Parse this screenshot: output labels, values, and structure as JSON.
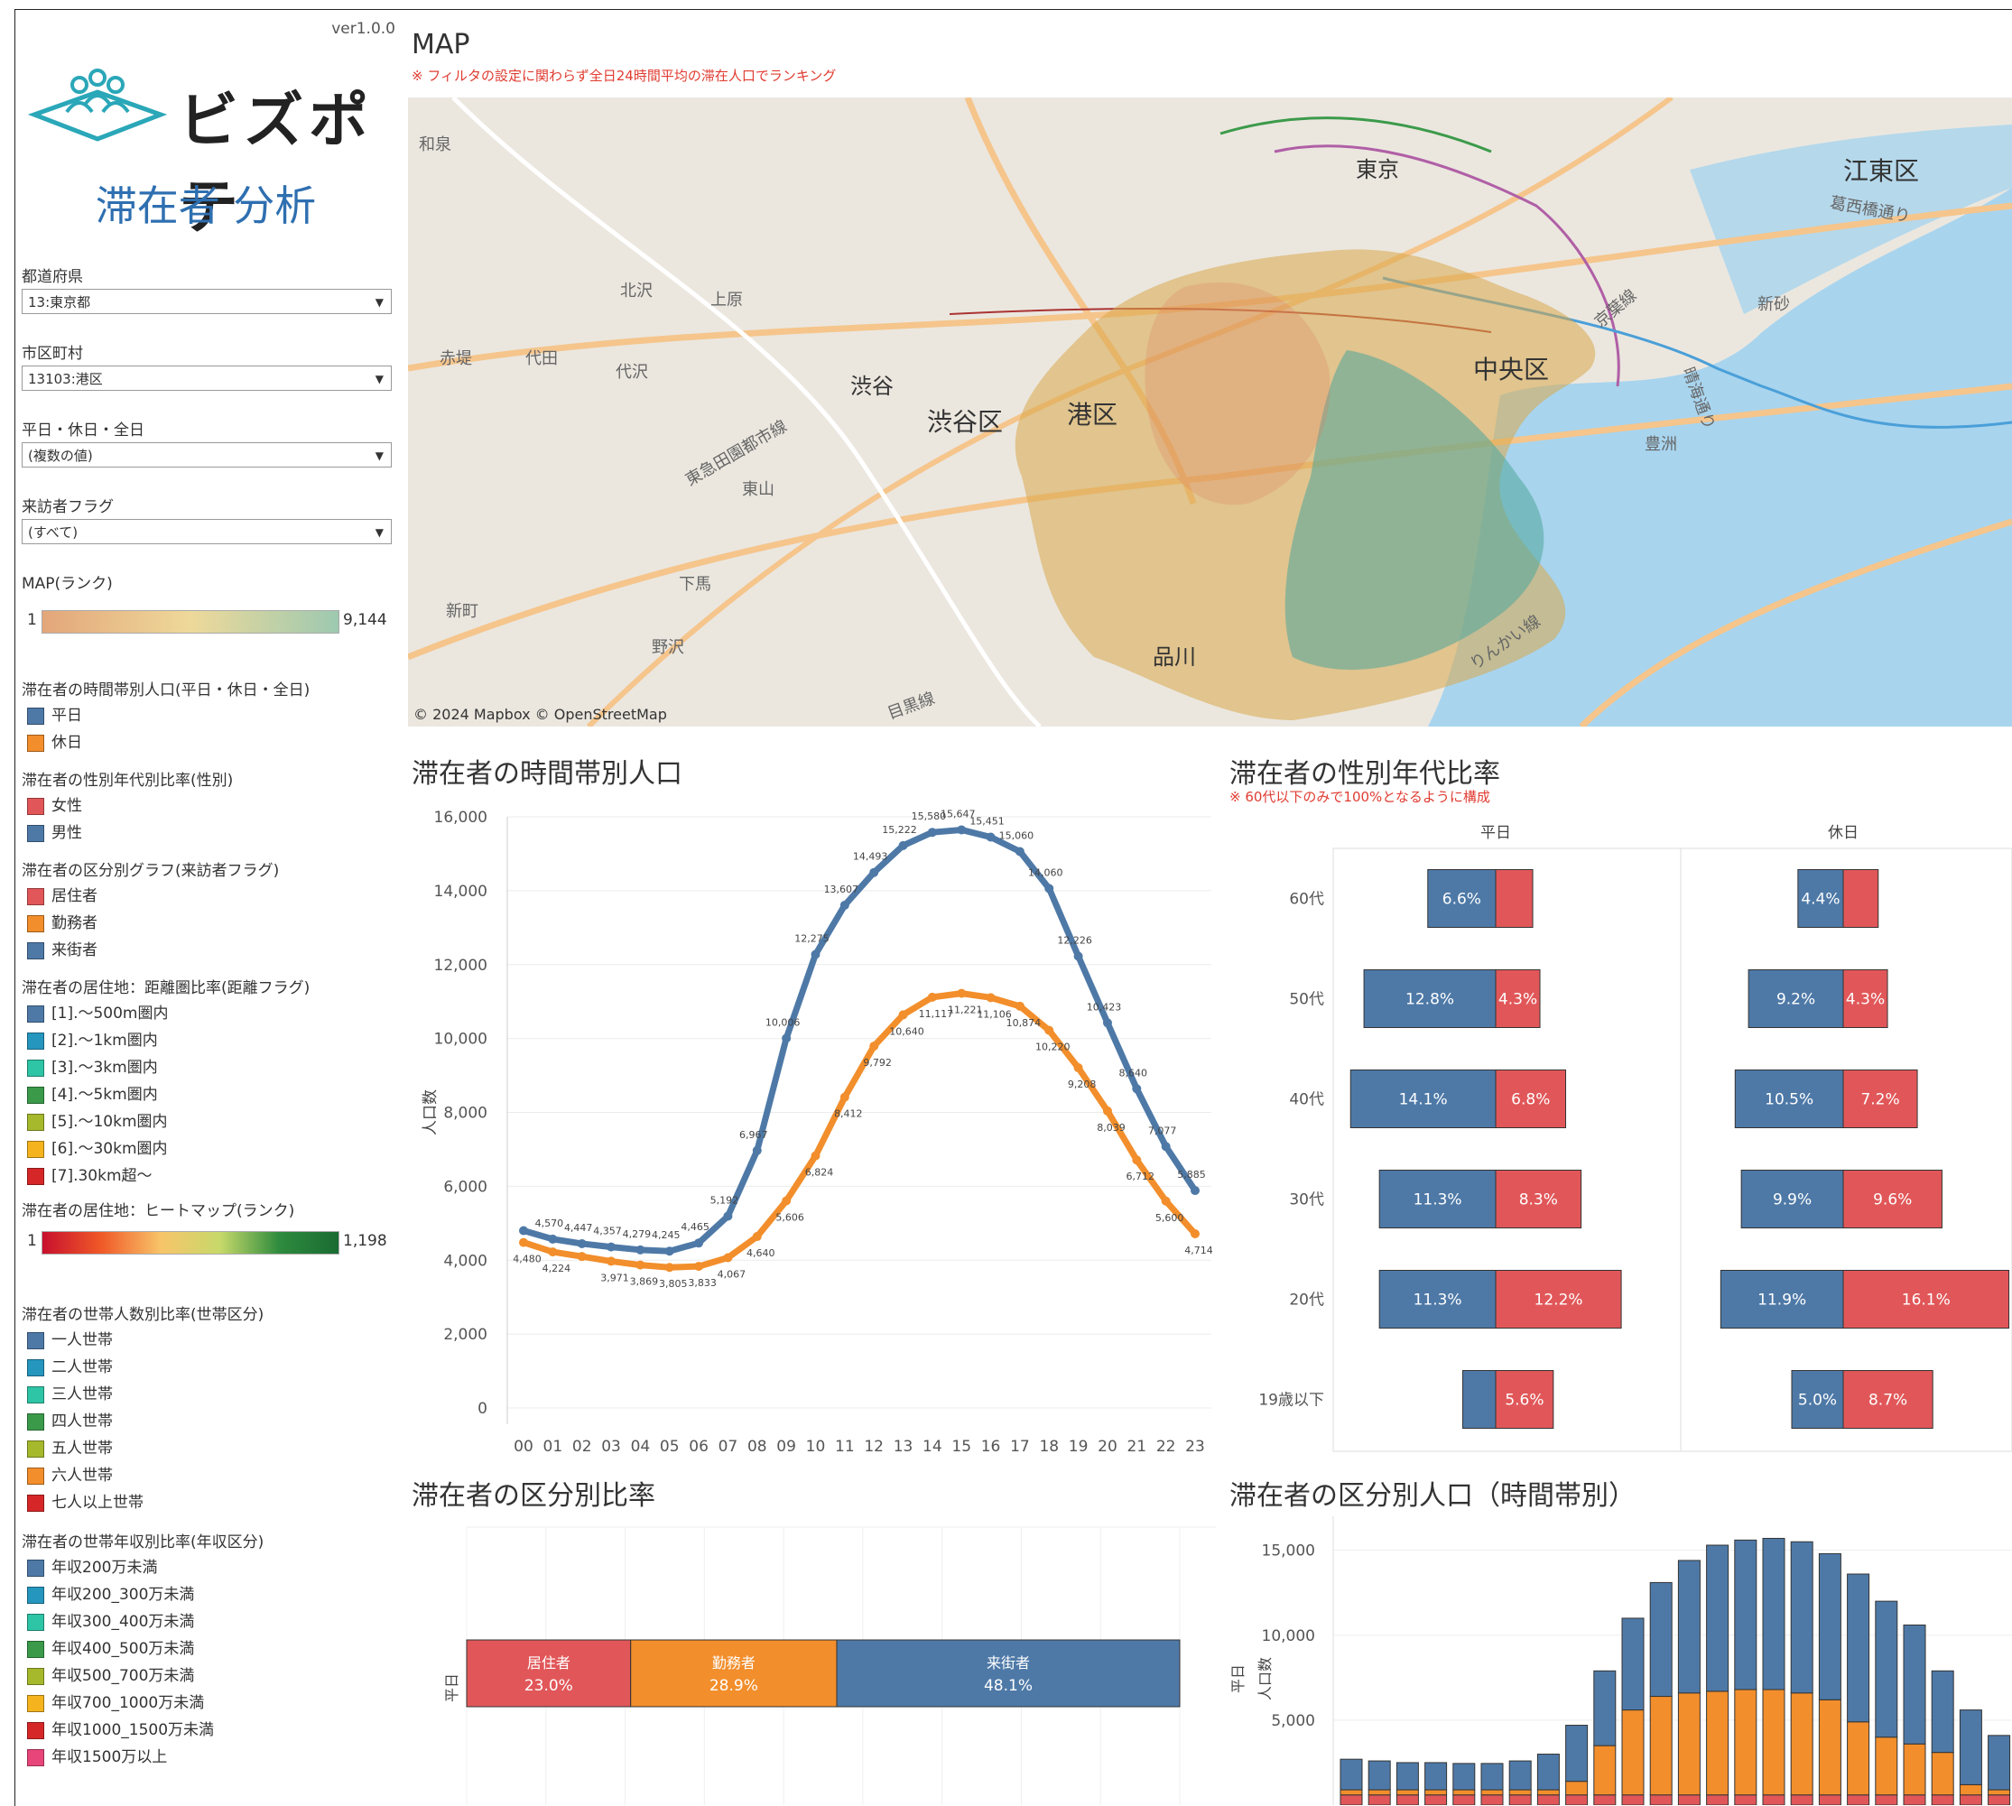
{
  "version": "ver1.0.0",
  "app": {
    "logo_text": "ビズポテ",
    "subtitle": "滞在者 分析"
  },
  "filters": [
    {
      "label": "都道府県",
      "value": "13:東京都"
    },
    {
      "label": "市区町村",
      "value": "13103:港区"
    },
    {
      "label": "平日・休日・全日",
      "value": "(複数の値)"
    },
    {
      "label": "来訪者フラグ",
      "value": "(すべて)"
    }
  ],
  "map_rank": {
    "title": "MAP(ランク)",
    "min": "1",
    "max": "9,144"
  },
  "legend_time": {
    "title": "滞在者の時間帯別人口(平日・休日・全日)",
    "items": [
      {
        "label": "平日",
        "color": "#4e79a7"
      },
      {
        "label": "休日",
        "color": "#f28e2b"
      }
    ]
  },
  "legend_gender": {
    "title": "滞在者の性別年代別比率(性別)",
    "items": [
      {
        "label": "女性",
        "color": "#e15759"
      },
      {
        "label": "男性",
        "color": "#4e79a7"
      }
    ]
  },
  "legend_kubun": {
    "title": "滞在者の区分別グラフ(来訪者フラグ)",
    "items": [
      {
        "label": "居住者",
        "color": "#e15759"
      },
      {
        "label": "勤務者",
        "color": "#f28e2b"
      },
      {
        "label": "来街者",
        "color": "#4e79a7"
      }
    ]
  },
  "legend_distance": {
    "title": "滞在者の居住地：距離圏比率(距離フラグ)",
    "items": [
      {
        "label": "[1].〜500m圏内",
        "color": "#4e79a7"
      },
      {
        "label": "[2].〜1km圏内",
        "color": "#2596be"
      },
      {
        "label": "[3].〜3km圏内",
        "color": "#2ec4a6"
      },
      {
        "label": "[4].〜5km圏内",
        "color": "#3a9a4a"
      },
      {
        "label": "[5].〜10km圏内",
        "color": "#a6b82c"
      },
      {
        "label": "[6].〜30km圏内",
        "color": "#f5b41e"
      },
      {
        "label": "[7].30km超〜",
        "color": "#d62728"
      }
    ]
  },
  "heatmap_rank": {
    "title": "滞在者の居住地：ヒートマップ(ランク)",
    "min": "1",
    "max": "1,198"
  },
  "legend_household": {
    "title": "滞在者の世帯人数別比率(世帯区分)",
    "items": [
      {
        "label": "一人世帯",
        "color": "#4e79a7"
      },
      {
        "label": "二人世帯",
        "color": "#2596be"
      },
      {
        "label": "三人世帯",
        "color": "#2ec4a6"
      },
      {
        "label": "四人世帯",
        "color": "#3a9a4a"
      },
      {
        "label": "五人世帯",
        "color": "#a6b82c"
      },
      {
        "label": "六人世帯",
        "color": "#f28e2b"
      },
      {
        "label": "七人以上世帯",
        "color": "#d62728"
      }
    ]
  },
  "legend_income": {
    "title": "滞在者の世帯年収別比率(年収区分)",
    "items": [
      {
        "label": "年収200万未満",
        "color": "#4e79a7"
      },
      {
        "label": "年収200_300万未満",
        "color": "#2596be"
      },
      {
        "label": "年収300_400万未満",
        "color": "#2ec4a6"
      },
      {
        "label": "年収400_500万未満",
        "color": "#3a9a4a"
      },
      {
        "label": "年収500_700万未満",
        "color": "#a6b82c"
      },
      {
        "label": "年収700_1000万未満",
        "color": "#f5b41e"
      },
      {
        "label": "年収1000_1500万未満",
        "color": "#d62728"
      },
      {
        "label": "年収1500万以上",
        "color": "#e8457a"
      }
    ]
  },
  "map": {
    "title": "MAP",
    "note": "※ フィルタの設定に関わらず全日24時間平均の滞在人口でランキング",
    "credit": "© 2024 Mapbox © OpenStreetMap",
    "labels": {
      "koto": "江東区",
      "chuo": "中央区",
      "shibuya_ku": "渋谷区",
      "minato": "港区",
      "tokyo": "東京",
      "shibuya": "渋谷",
      "shinagawa": "品川",
      "wasen": "和泉",
      "kitazawa": "北沢",
      "uehara": "上原",
      "akatsutsumi": "赤堤",
      "daita": "代田",
      "daizawa": "代沢",
      "higashiyama": "東山",
      "shimouma": "下馬",
      "shincho": "新町",
      "nozawa": "野沢",
      "shinsuna": "新砂",
      "toyosu": "豊洲",
      "rinkai": "りんかい線",
      "meguro": "目黒線",
      "denentoshi": "東急田園都市線",
      "keiyo": "京葉線",
      "harumi": "晴海通り",
      "kasai": "葛西橋通り"
    }
  },
  "chart_time": {
    "title": "滞在者の時間帯別人口",
    "ylabel": "人口数",
    "chart_data": {
      "type": "line",
      "x": [
        "00",
        "01",
        "02",
        "03",
        "04",
        "05",
        "06",
        "07",
        "08",
        "09",
        "10",
        "11",
        "12",
        "13",
        "14",
        "15",
        "16",
        "17",
        "18",
        "19",
        "20",
        "21",
        "22",
        "23"
      ],
      "ylim": [
        0,
        16000
      ],
      "yticks": [
        "0",
        "2,000",
        "4,000",
        "6,000",
        "8,000",
        "10,000",
        "12,000",
        "14,000",
        "16,000"
      ],
      "series": [
        {
          "name": "平日",
          "color": "#4e79a7",
          "values": [
            4800,
            4570,
            4447,
            4357,
            4279,
            4245,
            4465,
            5192,
            6967,
            10006,
            12275,
            13607,
            14493,
            15222,
            15580,
            15647,
            15451,
            15060,
            14060,
            12226,
            10423,
            8640,
            7077,
            5885
          ],
          "labels": [
            "",
            "4,570",
            "4,447",
            "4,357",
            "4,279",
            "4,245",
            "4,465",
            "5,192",
            "6,967",
            "10,006",
            "12,275",
            "13,607",
            "14,493",
            "15,222",
            "15,580",
            "15,647",
            "15,451",
            "15,060",
            "14,060",
            "12,226",
            "10,423",
            "8,640",
            "7,077",
            "5,885"
          ]
        },
        {
          "name": "休日",
          "color": "#f28e2b",
          "values": [
            4480,
            4224,
            4100,
            3971,
            3869,
            3805,
            3833,
            4067,
            4640,
            5606,
            6824,
            8412,
            9792,
            10640,
            11117,
            11221,
            11106,
            10874,
            10220,
            9208,
            8039,
            6712,
            5600,
            4714
          ],
          "labels": [
            "4,480",
            "4,224",
            "",
            "3,971",
            "3,869",
            "3,805",
            "3,833",
            "4,067",
            "4,640",
            "5,606",
            "6,824",
            "8,412",
            "9,792",
            "10,640",
            "11,117",
            "11,221",
            "11,106",
            "10,874",
            "10,220",
            "9,208",
            "8,039",
            "6,712",
            "5,600",
            "4,714"
          ]
        }
      ]
    }
  },
  "chart_gender": {
    "title": "滞在者の性別年代比率",
    "note": "※ 60代以下のみで100%となるように構成",
    "chart_data": {
      "type": "bar",
      "categories": [
        "60代",
        "50代",
        "40代",
        "30代",
        "20代",
        "19歳以下"
      ],
      "panels": [
        {
          "name": "平日",
          "male": [
            6.6,
            12.8,
            14.1,
            11.3,
            11.3,
            3.2
          ],
          "female": [
            3.6,
            4.3,
            6.8,
            8.3,
            12.2,
            5.6
          ],
          "male_labels": [
            "6.6%",
            "12.8%",
            "14.1%",
            "11.3%",
            "11.3%",
            ""
          ],
          "female_labels": [
            "",
            "4.3%",
            "6.8%",
            "8.3%",
            "12.2%",
            "5.6%"
          ]
        },
        {
          "name": "休日",
          "male": [
            4.4,
            9.2,
            10.5,
            9.9,
            11.9,
            5.0
          ],
          "female": [
            3.4,
            4.3,
            7.2,
            9.6,
            16.1,
            8.7
          ],
          "male_labels": [
            "4.4%",
            "9.2%",
            "10.5%",
            "9.9%",
            "11.9%",
            "5.0%"
          ],
          "female_labels": [
            "",
            "4.3%",
            "7.2%",
            "9.6%",
            "16.1%",
            "8.7%"
          ]
        }
      ],
      "colors": {
        "male": "#4e79a7",
        "female": "#e15759"
      }
    }
  },
  "chart_kubun": {
    "title": "滞在者の区分別比率",
    "row_label": "平日",
    "chart_data": {
      "type": "bar",
      "segments": [
        {
          "name": "居住者",
          "value": 23.0,
          "label": "23.0%",
          "color": "#e15759"
        },
        {
          "name": "勤務者",
          "value": 28.9,
          "label": "28.9%",
          "color": "#f28e2b"
        },
        {
          "name": "来街者",
          "value": 48.1,
          "label": "48.1%",
          "color": "#4e79a7"
        }
      ]
    }
  },
  "chart_kubun_time": {
    "title": "滞在者の区分別人口（時間帯別）",
    "ylabel_outer": "平日",
    "ylabel": "人口数",
    "chart_data": {
      "type": "bar",
      "stacked": true,
      "ylim": [
        0,
        17000
      ],
      "yticks": [
        "5,000",
        "10,000",
        "15,000"
      ],
      "series": [
        {
          "name": "居住者",
          "color": "#e15759",
          "values": [
            600,
            600,
            600,
            600,
            600,
            600,
            600,
            600,
            600,
            600,
            600,
            600,
            600,
            600,
            600,
            600,
            600,
            600,
            600,
            600,
            600,
            600,
            600,
            600
          ]
        },
        {
          "name": "勤務者",
          "color": "#f28e2b",
          "values": [
            300,
            300,
            300,
            300,
            300,
            300,
            300,
            300,
            800,
            2900,
            5000,
            5800,
            6000,
            6100,
            6200,
            6200,
            6000,
            5600,
            4300,
            3400,
            3000,
            2500,
            600,
            300
          ]
        },
        {
          "name": "来街者",
          "color": "#4e79a7",
          "values": [
            1800,
            1700,
            1600,
            1600,
            1550,
            1550,
            1700,
            2100,
            3300,
            4400,
            5400,
            6700,
            7800,
            8600,
            8800,
            8900,
            8900,
            8600,
            8700,
            8000,
            7000,
            4800,
            4400,
            3200
          ]
        }
      ]
    }
  }
}
